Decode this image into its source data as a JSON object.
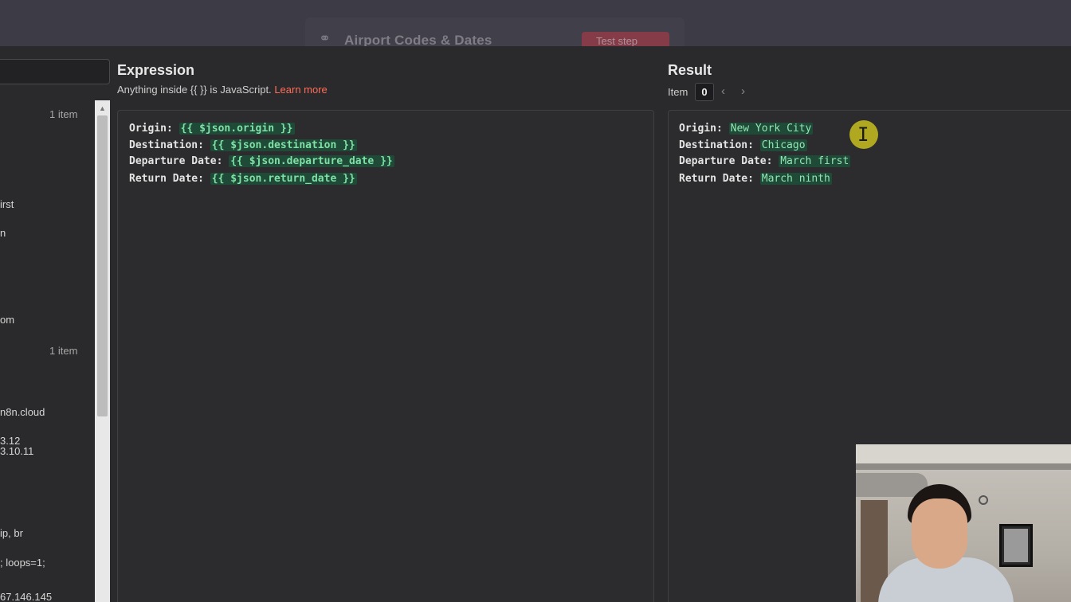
{
  "topbar": {
    "workflow_title": "Airport Codes & Dates",
    "test_step_label": "Test step",
    "workflow_icon": "link-icon"
  },
  "left_panel": {
    "count_1": "1 item",
    "count_2": "1 item",
    "fragments": [
      "irst",
      "n",
      "om",
      "n8n.cloud",
      "3.12",
      "3.10.11",
      "ip, br",
      "; loops=1;",
      "67.146.145"
    ]
  },
  "expression": {
    "title": "Expression",
    "hint_prefix": "Anything inside {{  }} is JavaScript.",
    "learn_more": "Learn more",
    "lines": [
      {
        "label": "Origin:",
        "expr": "{{ $json.origin }}"
      },
      {
        "label": "Destination:",
        "expr": "{{ $json.destination }}"
      },
      {
        "label": "Departure Date:",
        "expr": "{{ $json.departure_date }}"
      },
      {
        "label": "Return Date:",
        "expr": "{{ $json.return_date }}"
      }
    ]
  },
  "result": {
    "title": "Result",
    "item_label": "Item",
    "item_index": "0",
    "prev_icon": "chevron-left-icon",
    "next_icon": "chevron-right-icon",
    "lines": [
      {
        "label": "Origin:",
        "value": "New York City"
      },
      {
        "label": "Destination:",
        "value": "Chicago"
      },
      {
        "label": "Departure Date:",
        "value": "March first"
      },
      {
        "label": "Return Date:",
        "value": "March ninth"
      }
    ]
  },
  "colors": {
    "accent_link": "#ff6d5a",
    "expr_highlight": "#1f4a37",
    "expr_text": "#7fe0a6",
    "cursor_highlight": "#c8be1e"
  }
}
